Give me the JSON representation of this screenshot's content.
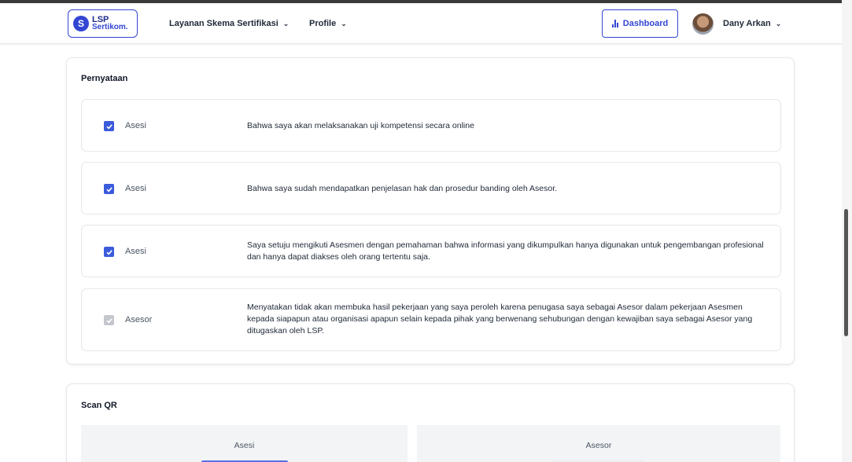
{
  "navbar": {
    "logo": {
      "line1": "LSP",
      "line2": "Sertikom."
    },
    "menu_layanan": "Layanan Skema Sertifikasi",
    "menu_profile": "Profile",
    "dashboard_button": "Dashboard",
    "user_name": "Dany Arkan"
  },
  "pernyataan": {
    "title": "Pernyataan",
    "items": [
      {
        "role": "Asesi",
        "checked": true,
        "disabled": false,
        "text": "Bahwa saya akan melaksanakan uji kompetensi secara online"
      },
      {
        "role": "Asesi",
        "checked": true,
        "disabled": false,
        "text": "Bahwa saya sudah mendapatkan penjelasan hak dan prosedur banding oleh Asesor."
      },
      {
        "role": "Asesi",
        "checked": true,
        "disabled": false,
        "text": "Saya setuju mengikuti Asesmen dengan pemahaman bahwa informasi yang dikumpulkan hanya digunakan untuk pengembangan profesional dan hanya dapat diakses oleh orang tertentu saja."
      },
      {
        "role": "Asesor",
        "checked": true,
        "disabled": true,
        "text": "Menyatakan tidak akan membuka hasil pekerjaan yang saya peroleh karena penugasa saya sebagai Asesor dalam pekerjaan Asesmen kepada siapapun atau organisasi apapun selain kepada pihak yang berwenang sehubungan dengan kewajiban saya sebagai Asesor yang ditugaskan oleh LSP."
      }
    ]
  },
  "scan_qr": {
    "title": "Scan QR",
    "asesi_label": "Asesi",
    "asesor_label": "Asesor"
  },
  "colors": {
    "primary": "#3346d3",
    "checkbox": "#3b5bdb",
    "checkbox_disabled": "#c4c7cc"
  }
}
